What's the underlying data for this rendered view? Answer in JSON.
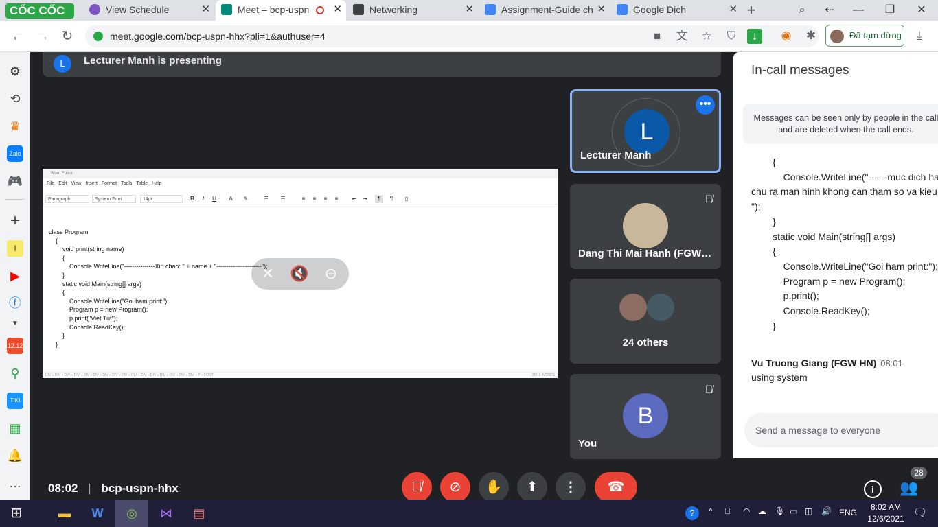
{
  "browser": {
    "brand": "CỐC CỐC",
    "tabs": [
      {
        "label": "View Schedule",
        "icon": "web-icon"
      },
      {
        "label": "Meet – bcp-uspn",
        "icon": "google-meet-icon",
        "active": true
      },
      {
        "label": "Networking",
        "icon": "document-icon"
      },
      {
        "label": "Assignment-Guide ch",
        "icon": "google-docs-icon"
      },
      {
        "label": "Google Dịch",
        "icon": "google-translate-icon"
      }
    ],
    "url": "meet.google.com/bcp-uspn-hhx?pli=1&authuser=4",
    "profile_status": "Đã tạm dừng"
  },
  "presenting": {
    "avatar_letter": "L",
    "text": "Lecturer Manh is presenting"
  },
  "shared_screen": {
    "window_title": "Word Editor",
    "menu": [
      "File",
      "Edit",
      "View",
      "Insert",
      "Format",
      "Tools",
      "Table",
      "Help"
    ],
    "style_select": "Paragraph",
    "font_select": "System Font",
    "size_select": "14pt",
    "code": "class Program\n    {\n        void print(string name)\n        {\n            Console.WriteLine(\"---------------Xin chao: \" + name + \"----------------------\");\n        }\n        static void Main(string[] args)\n        {\n            Console.WriteLine(\"Goi ham print:\");\n            Program p = new Program();\n            p.print(\"Viet Tut\");\n            Console.ReadKey();\n        }\n    }",
    "status_left": "DIV » DIV » DIV » DIV » DIV » DIV » DIV » DIV » DIV » DIV » DIV » DIV » DIV » DIV » DIV » DIV » P » FONT",
    "status_right": "30/19 WORDS"
  },
  "participants": [
    {
      "name": "Lecturer Manh",
      "letter": "L",
      "color": "#0b57a8",
      "mic_off": false,
      "highlight": true
    },
    {
      "name": "Dang Thi Mai Hanh (FGW HN)",
      "mic_off": true
    },
    {
      "name": "24 others"
    },
    {
      "name": "You",
      "letter": "B",
      "color": "#5c6bc0",
      "mic_off": true
    }
  ],
  "meeting": {
    "time": "08:02",
    "code": "bcp-uspn-hhx",
    "participant_count": "28"
  },
  "chat": {
    "title": "In-call messages",
    "notice": "Messages can be seen only by people in the call and are deleted when the call ends.",
    "code_snippet": "        {\n            Console.WriteLine(\"------muc dich ham\nchu ra man hinh khong can tham so va kieu\n\");\n        }\n        static void Main(string[] args)\n        {\n            Console.WriteLine(\"Goi ham print:\");\n            Program p = new Program();\n            p.print();\n            Console.ReadKey();\n        }",
    "last_sender": "Vu Truong Giang (FGW HN)",
    "last_time": "08:01",
    "last_message": "using system",
    "input_placeholder": "Send a message to everyone"
  },
  "taskbar": {
    "lang": "ENG",
    "time": "8:02 AM",
    "date": "12/6/2021"
  }
}
